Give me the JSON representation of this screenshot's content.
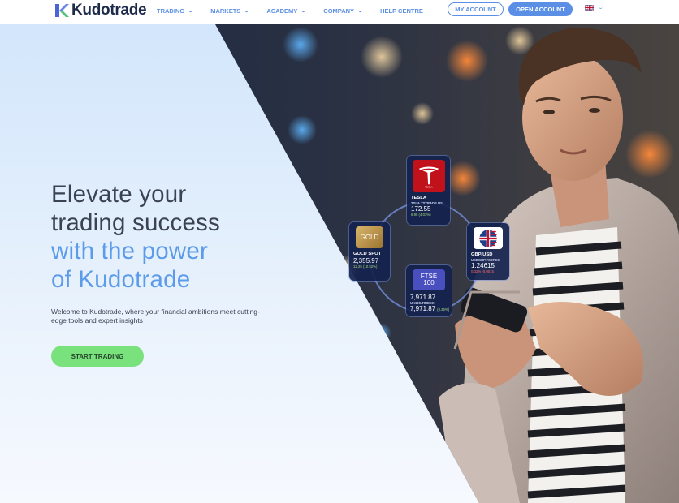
{
  "brand": {
    "name": "Kudotrade"
  },
  "nav": {
    "items": [
      {
        "label": "TRADING",
        "dropdown": true
      },
      {
        "label": "MARKETS",
        "dropdown": true
      },
      {
        "label": "ACADEMY",
        "dropdown": true
      },
      {
        "label": "COMPANY",
        "dropdown": true
      },
      {
        "label": "HELP CENTRE",
        "dropdown": false
      }
    ],
    "my_account": "MY ACCOUNT",
    "open_account": "OPEN ACCOUNT",
    "language_icon": "uk-flag-icon"
  },
  "hero": {
    "headline_line1": "Elevate your",
    "headline_line2": "trading success",
    "headline_line3": "with the power",
    "headline_line4": "of Kudotrade",
    "subtext": "Welcome to Kudotrade, where your financial ambitions meet cutting-edge tools and expert insights",
    "cta": "START TRADING"
  },
  "tickers": {
    "tesla": {
      "logo_text": "TESLA",
      "name": "TESLA",
      "sub": "TSLA.TSTRADE.US",
      "price": "172.55",
      "change": "6.95 (4.03%)",
      "direction": "up"
    },
    "gold": {
      "logo_text": "GOLD",
      "name": "GOLD SPOT",
      "price": "2,355.97",
      "change": "12.25 (10.52%)",
      "direction": "up"
    },
    "gbpusd": {
      "name": "GBP/USD",
      "sub": "USDGBP.TSDREX",
      "price": "1.24615",
      "change": "0.32% -0.0015",
      "direction": "down"
    },
    "ftse": {
      "logo_text": "FTSE 100",
      "price_top": "7,971.87",
      "sub": "UK100.TINDEX",
      "price": "7,971.87",
      "change": "(0.35%)",
      "direction": "up"
    }
  },
  "colors": {
    "accent": "#5b8fe6",
    "headline_accent": "#5b9bea",
    "cta_green": "#79e27c",
    "text_dark": "#3b4252"
  }
}
